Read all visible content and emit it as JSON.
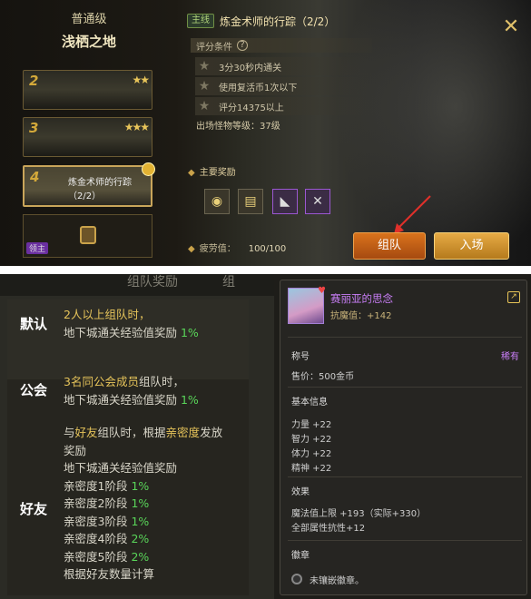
{
  "top": {
    "difficulty": "普通级",
    "stage_name": "浅栖之地",
    "cards": [
      {
        "num": "2",
        "stars": "★★",
        "name": ""
      },
      {
        "num": "3",
        "stars": "★★★",
        "name": ""
      },
      {
        "num": "4",
        "stars": "",
        "name": "炼金术师的行踪（2/2）"
      }
    ],
    "locked_tag": "领主",
    "quest_tag": "主线",
    "quest_title": "炼金术师的行踪（2/2）",
    "close_icon": "✕",
    "conditions_header": "评分条件",
    "help_icon": "?",
    "conditions": [
      "3分30秒内通关",
      "使用复活币1次以下",
      "评分14375以上"
    ],
    "monster_level": "出场怪物等级：37级",
    "main_rewards": "主要奖励",
    "fatigue_label": "疲劳值：",
    "fatigue_value": "100/100",
    "team_button": "组队",
    "enter_button": "入场"
  },
  "bottom_left": {
    "header_fragment": "组队奖励",
    "header_fragment2": "组",
    "sections": [
      {
        "tag": "默认",
        "lines": [
          {
            "parts": [
              {
                "t": "2人以上组队时，",
                "c": "y"
              }
            ]
          },
          {
            "parts": [
              {
                "t": "地下城通关经验值奖励 ",
                "c": ""
              },
              {
                "t": "1%",
                "c": "g"
              }
            ]
          }
        ]
      },
      {
        "tag": "公会",
        "lines": [
          {
            "parts": [
              {
                "t": "3名同公会成员",
                "c": "y"
              },
              {
                "t": "组队时，",
                "c": ""
              }
            ]
          },
          {
            "parts": [
              {
                "t": "地下城通关经验值奖励 ",
                "c": ""
              },
              {
                "t": "1%",
                "c": "g"
              }
            ]
          }
        ]
      },
      {
        "tag": "好友",
        "lines": [
          {
            "parts": [
              {
                "t": "与",
                "c": ""
              },
              {
                "t": "好友",
                "c": "y"
              },
              {
                "t": "组队时，根据",
                "c": ""
              },
              {
                "t": "亲密度",
                "c": "y"
              },
              {
                "t": "发放",
                "c": ""
              }
            ]
          },
          {
            "parts": [
              {
                "t": "奖励",
                "c": ""
              }
            ]
          },
          {
            "parts": [
              {
                "t": "地下城通关经验值奖励",
                "c": ""
              }
            ]
          },
          {
            "parts": [
              {
                "t": "亲密度1阶段 ",
                "c": ""
              },
              {
                "t": "1%",
                "c": "g"
              }
            ]
          },
          {
            "parts": [
              {
                "t": "亲密度2阶段 ",
                "c": ""
              },
              {
                "t": "1%",
                "c": "g"
              }
            ]
          },
          {
            "parts": [
              {
                "t": "亲密度3阶段 ",
                "c": ""
              },
              {
                "t": "1%",
                "c": "g"
              }
            ]
          },
          {
            "parts": [
              {
                "t": "亲密度4阶段 ",
                "c": ""
              },
              {
                "t": "2%",
                "c": "g"
              }
            ]
          },
          {
            "parts": [
              {
                "t": "亲密度5阶段 ",
                "c": ""
              },
              {
                "t": "2%",
                "c": "g"
              }
            ]
          },
          {
            "parts": [
              {
                "t": "根据好友数量计算",
                "c": ""
              }
            ]
          }
        ]
      }
    ]
  },
  "bottom_right": {
    "item_name": "赛丽亚的思念",
    "item_sub": "抗魔值：+142",
    "title_label": "称号",
    "rarity": "稀有",
    "price": "售价：500金币",
    "basic_info": "基本信息",
    "stats": [
      "力量 +22",
      "智力 +22",
      "体力 +22",
      "精神 +22"
    ],
    "effect_label": "效果",
    "effects": [
      "魔法值上限 +193（实际+330）",
      "全部属性抗性+12"
    ],
    "emblem_label": "徽章",
    "emblem_value": "未镶嵌徽章。"
  }
}
